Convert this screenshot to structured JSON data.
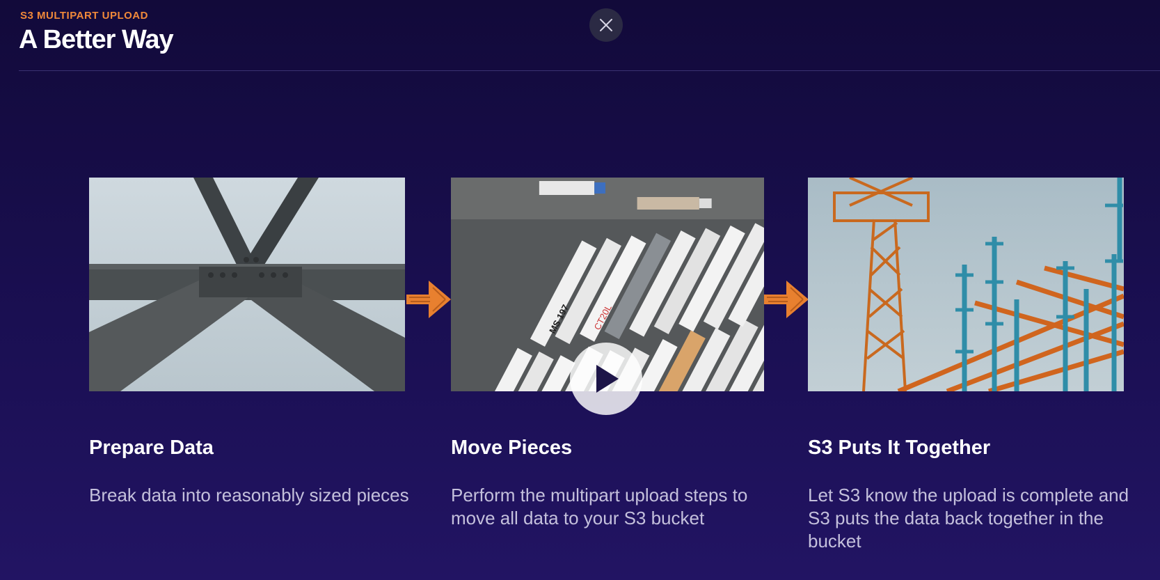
{
  "header": {
    "eyebrow": "S3 MULTIPART UPLOAD",
    "title": "A Better Way"
  },
  "close_icon": "close-icon",
  "steps": [
    {
      "title": "Prepare Data",
      "description": "Break data into reasonably sized pieces",
      "image": "steel-beams-photo"
    },
    {
      "title": "Move Pieces",
      "description": "Perform the multipart upload steps to move all data to your S3 bucket",
      "image": "trucks-aerial-photo",
      "truck_labels": [
        "MS 197",
        "CT20L"
      ]
    },
    {
      "title": "S3 Puts It Together",
      "description": "Let S3 know the upload is complete and S3 puts the data back together in the bucket",
      "image": "construction-crane-photo"
    }
  ],
  "play_icon": "play-icon",
  "colors": {
    "accent": "#f0893a",
    "background": "#1a0f52",
    "text": "#ffffff",
    "muted_text": "#c4c0dc"
  }
}
